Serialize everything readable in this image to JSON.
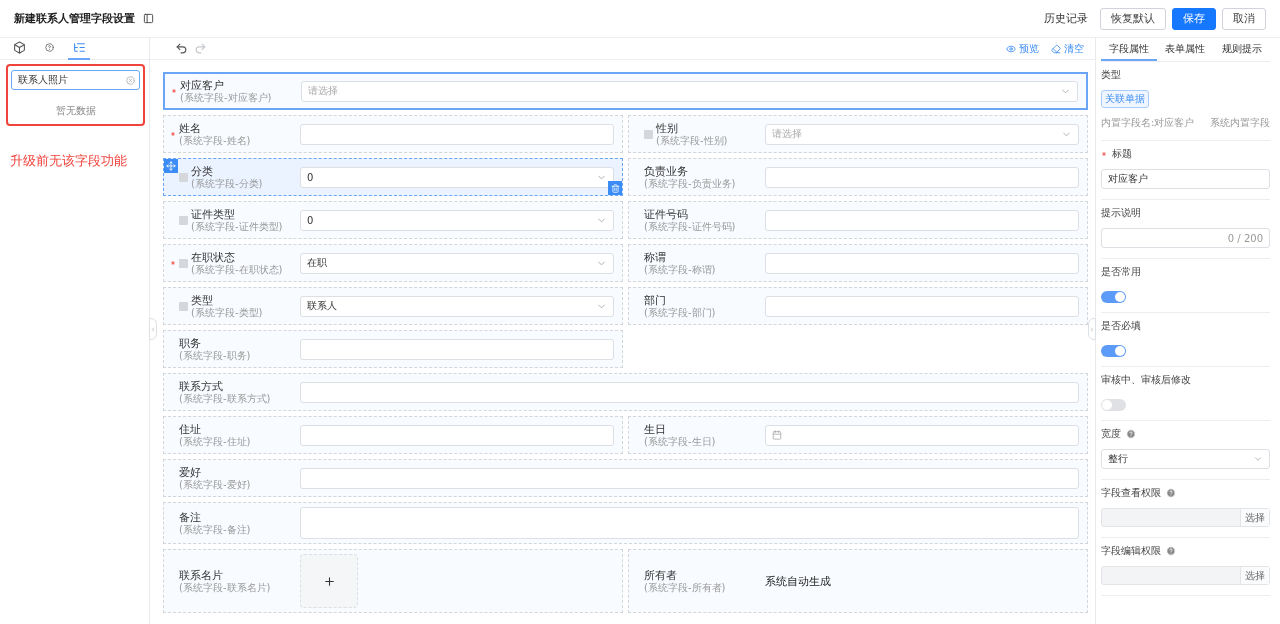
{
  "header": {
    "title": "新建联系人管理字段设置",
    "actions": [
      {
        "label": "历史记录",
        "kind": "text"
      },
      {
        "label": "恢复默认",
        "kind": "default"
      },
      {
        "label": "保存",
        "kind": "primary"
      },
      {
        "label": "取消",
        "kind": "default"
      }
    ]
  },
  "left_panel": {
    "tabs": [
      {
        "kind": "cube",
        "selected": false
      },
      {
        "kind": "help",
        "selected": false
      },
      {
        "kind": "tree",
        "selected": true
      }
    ],
    "search": {
      "value": "联系人照片"
    },
    "empty_text": "暂无数据",
    "note": "升级前无该字段功能"
  },
  "toolbar": {
    "history": [
      {
        "kind": "undo",
        "disabled": false
      },
      {
        "kind": "redo",
        "disabled": true
      }
    ],
    "actions": [
      {
        "kind": "preview",
        "label": "预览"
      },
      {
        "kind": "clear",
        "label": "清空"
      }
    ]
  },
  "form": {
    "rows": [
      {
        "kind": "full",
        "fields": [
          {
            "label": "对应客户",
            "sublabel": "(系统字段-对应客户)",
            "kind": "select",
            "placeholder": "请选择",
            "required": true,
            "selected": true,
            "hovered": false
          }
        ]
      },
      {
        "kind": "split",
        "fields": [
          {
            "label": "姓名",
            "sublabel": "(系统字段-姓名)",
            "kind": "input",
            "required": true,
            "selected": false,
            "hovered": false
          },
          {
            "label": "性别",
            "sublabel": "(系统字段-性别)",
            "kind": "select",
            "placeholder": "请选择",
            "checked": false,
            "required": false,
            "selected": false,
            "hovered": false
          }
        ]
      },
      {
        "kind": "split",
        "fields": [
          {
            "label": "分类",
            "sublabel": "(系统字段-分类)",
            "kind": "select",
            "value": "0",
            "checked": false,
            "required": false,
            "selected": false,
            "hovered": true
          },
          {
            "label": "负责业务",
            "sublabel": "(系统字段-负责业务)",
            "kind": "input",
            "required": false,
            "selected": false,
            "hovered": false
          }
        ]
      },
      {
        "kind": "split",
        "fields": [
          {
            "label": "证件类型",
            "sublabel": "(系统字段-证件类型)",
            "kind": "select",
            "value": "0",
            "checked": false,
            "required": false,
            "selected": false,
            "hovered": false
          },
          {
            "label": "证件号码",
            "sublabel": "(系统字段-证件号码)",
            "kind": "input",
            "required": false,
            "selected": false,
            "hovered": false
          }
        ]
      },
      {
        "kind": "split",
        "fields": [
          {
            "label": "在职状态",
            "sublabel": "(系统字段-在职状态)",
            "kind": "select",
            "value": "在职",
            "checked": false,
            "required": true,
            "selected": false,
            "hovered": false
          },
          {
            "label": "称谓",
            "sublabel": "(系统字段-称谓)",
            "kind": "input",
            "required": false,
            "selected": false,
            "hovered": false
          }
        ]
      },
      {
        "kind": "split",
        "fields": [
          {
            "label": "类型",
            "sublabel": "(系统字段-类型)",
            "kind": "select",
            "value": "联系人",
            "checked": false,
            "required": false,
            "selected": false,
            "hovered": false
          },
          {
            "label": "部门",
            "sublabel": "(系统字段-部门)",
            "kind": "input",
            "required": false,
            "selected": false,
            "hovered": false
          }
        ]
      },
      {
        "kind": "split",
        "fields": [
          {
            "label": "职务",
            "sublabel": "(系统字段-职务)",
            "kind": "input",
            "required": false,
            "selected": false,
            "hovered": false
          }
        ]
      },
      {
        "kind": "full",
        "fields": [
          {
            "label": "联系方式",
            "sublabel": "(系统字段-联系方式)",
            "kind": "input",
            "required": false,
            "selected": false,
            "hovered": false
          }
        ]
      },
      {
        "kind": "split",
        "fields": [
          {
            "label": "住址",
            "sublabel": "(系统字段-住址)",
            "kind": "input",
            "required": false,
            "selected": false,
            "hovered": false
          },
          {
            "label": "生日",
            "sublabel": "(系统字段-生日)",
            "kind": "date",
            "required": false,
            "selected": false,
            "hovered": false
          }
        ]
      },
      {
        "kind": "full",
        "fields": [
          {
            "label": "爱好",
            "sublabel": "(系统字段-爱好)",
            "kind": "input",
            "required": false,
            "selected": false,
            "hovered": false
          }
        ]
      },
      {
        "kind": "full",
        "fields": [
          {
            "label": "备注",
            "sublabel": "(系统字段-备注)",
            "kind": "textarea",
            "required": false,
            "selected": false,
            "hovered": false
          }
        ]
      },
      {
        "kind": "split",
        "fields": [
          {
            "label": "联系名片",
            "sublabel": "(系统字段-联系名片)",
            "kind": "upload",
            "required": false,
            "selected": false,
            "hovered": false
          },
          {
            "label": "所有者",
            "sublabel": "(系统字段-所有者)",
            "kind": "static",
            "value": "系统自动生成",
            "required": false,
            "selected": false,
            "hovered": false
          }
        ]
      }
    ]
  },
  "right_panel": {
    "tabs": [
      {
        "label": "字段属性",
        "selected": true
      },
      {
        "label": "表单属性",
        "selected": false
      },
      {
        "label": "规则提示",
        "selected": false
      }
    ],
    "sections": [
      {
        "kind": "type",
        "label": "类型",
        "tag": "关联单据",
        "field_name": "内置字段名:对应客户",
        "source": "系统内置字段"
      },
      {
        "kind": "input",
        "label": "标题",
        "required": true,
        "value": "对应客户"
      },
      {
        "kind": "textarea",
        "label": "提示说明",
        "counter": "0 / 200"
      },
      {
        "kind": "switch",
        "label": "是否常用",
        "on": true
      },
      {
        "kind": "switch",
        "label": "是否必填",
        "on": true
      },
      {
        "kind": "switch",
        "label": "审核中、审核后修改",
        "on": false
      },
      {
        "kind": "select",
        "label": "宽度",
        "help": true,
        "value": "整行"
      },
      {
        "kind": "picker",
        "label": "字段查看权限",
        "help": true,
        "button": "选择"
      },
      {
        "kind": "picker",
        "label": "字段编辑权限",
        "help": true,
        "button": "选择"
      }
    ]
  }
}
